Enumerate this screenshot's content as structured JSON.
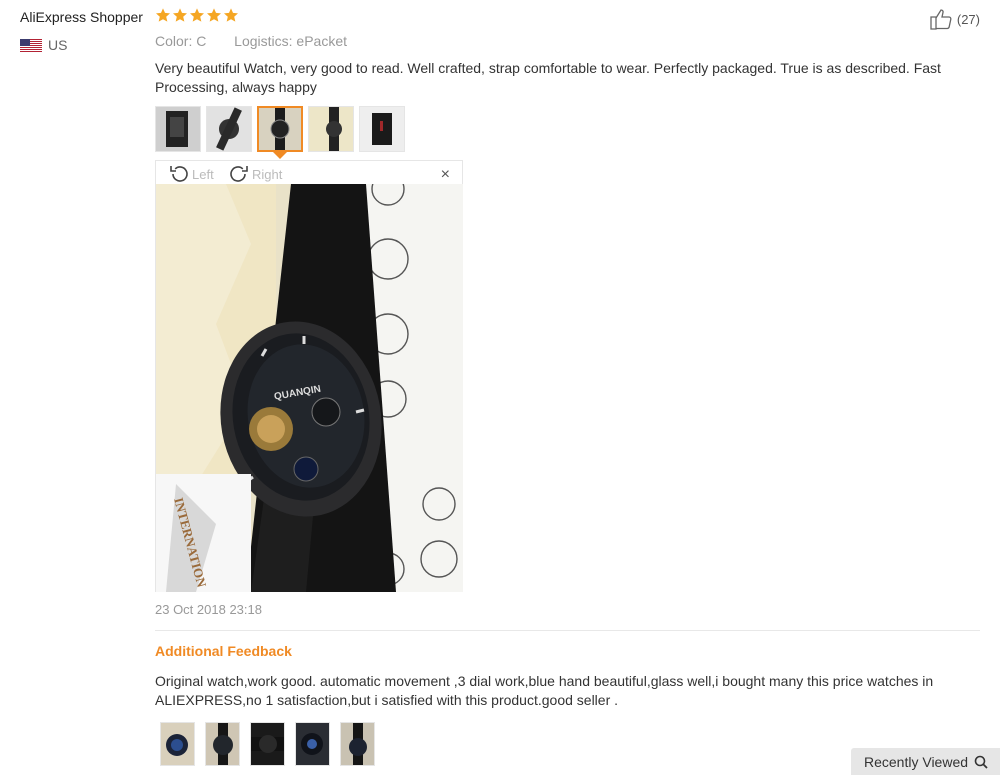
{
  "review": {
    "author": "AliExpress Shopper",
    "rating": 5,
    "country": "US",
    "color_label": "Color:",
    "color_value": "C",
    "logistics_label": "Logistics:",
    "logistics_value": "ePacket",
    "likes": "(27)",
    "text": "Very beautiful Watch, very good to read. Well crafted, strap comfortable to wear. Perfectly packaged. True is as described. Fast Processing, always happy",
    "date": "23 Oct 2018 23:18"
  },
  "viewer": {
    "rotate_left": "Left",
    "rotate_right": "Right",
    "close": "×",
    "brand_text": "QUANQIN",
    "card_text": "INTERNATION"
  },
  "additional": {
    "heading": "Additional Feedback",
    "text": "Original watch,work good. automatic movement ,3 dial work,blue hand beautiful,glass well,i bought many this price watches in ALIEXPRESS,no 1 satisfaction,but i satisfied with this product.good seller ."
  },
  "recently_viewed": {
    "label": "Recently Viewed"
  },
  "colors": {
    "accent": "#f08a24",
    "star": "#f5a623"
  }
}
